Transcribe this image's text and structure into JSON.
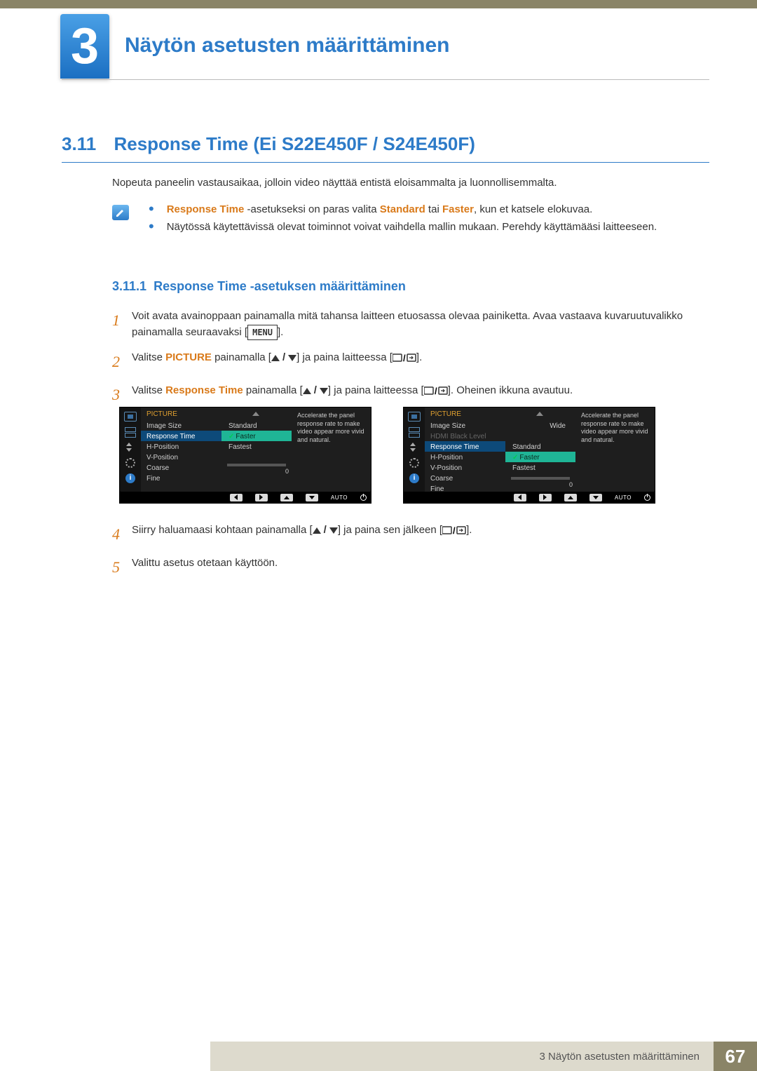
{
  "chapter": {
    "num": "3",
    "title": "Näytön asetusten määrittäminen"
  },
  "section": {
    "num": "3.11",
    "title": "Response Time (Ei S22E450F / S24E450F)"
  },
  "intro": "Nopeuta paneelin vastausaikaa, jolloin video näyttää entistä eloisammalta ja luonnollisemmalta.",
  "notes": {
    "n1a": "Response Time",
    "n1b": " -asetukseksi on paras valita ",
    "n1c": "Standard",
    "n1d": " tai ",
    "n1e": "Faster",
    "n1f": ", kun et katsele elokuvaa.",
    "n2": "Näytössä käytettävissä olevat toiminnot voivat vaihdella mallin mukaan. Perehdy käyttämääsi laitteeseen."
  },
  "subsection": {
    "num": "3.11.1",
    "title": "Response Time -asetuksen määrittäminen"
  },
  "steps": {
    "s1n": "1",
    "s1": "Voit avata avainoppaan painamalla mitä tahansa laitteen etuosassa olevaa painiketta. Avaa vastaava kuvaruutuvalikko painamalla seuraavaksi [",
    "s1_menu": "MENU",
    "s1_end": "].",
    "s2n": "2",
    "s2a": "Valitse ",
    "s2b": "PICTURE",
    "s2c": " painamalla [",
    "s2d": "] ja paina laitteessa [",
    "s2e": "].",
    "s3n": "3",
    "s3a": "Valitse ",
    "s3b": "Response Time",
    "s3c": " painamalla [",
    "s3d": "] ja paina laitteessa [",
    "s3e": "]. Oheinen ikkuna avautuu.",
    "s4n": "4",
    "s4a": "Siirry haluamaasi kohtaan painamalla [",
    "s4b": "] ja paina sen jälkeen [",
    "s4c": "].",
    "s5n": "5",
    "s5": "Valittu asetus otetaan käyttöön."
  },
  "osd": {
    "title": "PICTURE",
    "left": {
      "items": [
        "Image Size",
        "Response Time",
        "H-Position",
        "V-Position",
        "Coarse",
        "Fine"
      ],
      "opts": [
        "Standard",
        "Faster",
        "Fastest"
      ],
      "fine_val": "0"
    },
    "right": {
      "items": [
        "Image Size",
        "HDMI Black Level",
        "Response Time",
        "H-Position",
        "V-Position",
        "Coarse",
        "Fine"
      ],
      "wide": "Wide",
      "opts": [
        "Standard",
        "Faster",
        "Fastest"
      ],
      "fine_val": "0"
    },
    "desc": "Accelerate the panel response rate to make video appear more vivid and natural.",
    "nav_auto": "AUTO"
  },
  "footer": {
    "text": "3 Näytön asetusten määrittäminen",
    "page": "67"
  }
}
